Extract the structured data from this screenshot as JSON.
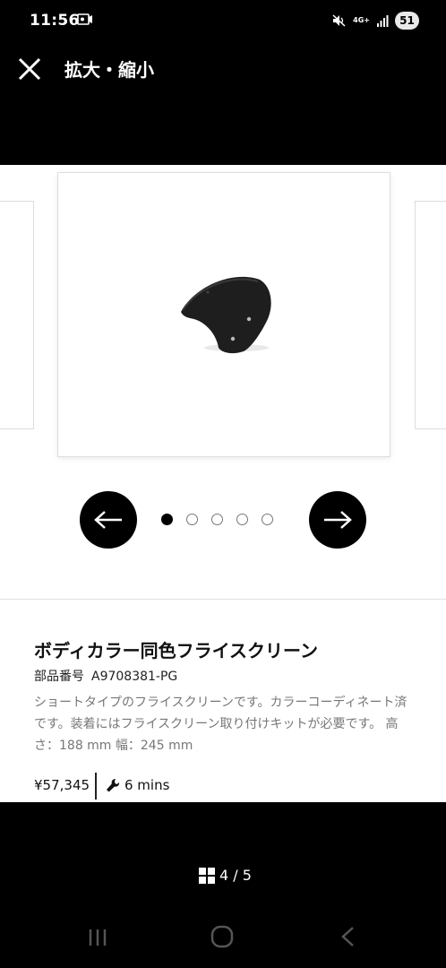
{
  "status_bar": {
    "time": "11:56",
    "battery": "51",
    "network": "4G+"
  },
  "header": {
    "title": "拡大・縮小"
  },
  "carousel": {
    "dots": 5,
    "active_dot": 0
  },
  "product": {
    "title": "ボディカラー同色フライスクリーン",
    "part_label": "部品番号",
    "part_number": "A9708381-PG",
    "description": "ショートタイプのフライスクリーンです。カラーコーディネート済です。装着にはフライスクリーン取り付けキットが必要です。 高さ：188 mm 幅：245 mm",
    "price": "¥57,345",
    "install_time": "6 mins"
  },
  "footer": {
    "page_indicator": "4 / 5"
  },
  "colors": {
    "background": "#000000",
    "panel": "#ffffff",
    "muted_text": "#777777"
  }
}
